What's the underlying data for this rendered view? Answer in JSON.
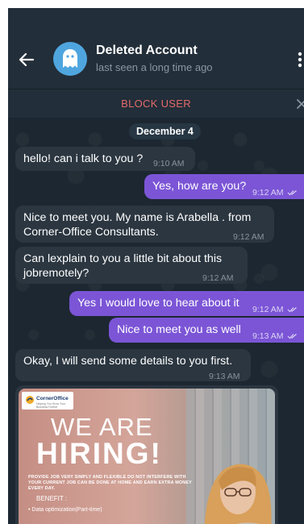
{
  "header": {
    "title": "Deleted Account",
    "status": "last seen a long time ago"
  },
  "block_bar": {
    "label": "BLOCK USER"
  },
  "date_separator": "December 4",
  "messages": [
    {
      "direction": "in",
      "text": "hello! can i talk to you ?",
      "time": "9:10 AM"
    },
    {
      "direction": "out",
      "text": "Yes, how are you?",
      "time": "9:12 AM",
      "read": true
    },
    {
      "direction": "in",
      "text_line1": "Nice to meet you. My name is Arabella . from",
      "text_line2": "Corner-Office Consultants.",
      "time": "9:12 AM"
    },
    {
      "direction": "in",
      "text_line1": "Can lexplain to you a little bit about this",
      "text_line2": "jobremotely?",
      "time": "9:12 AM"
    },
    {
      "direction": "out",
      "text": "Yes I would love to hear about it",
      "time": "9:12 AM",
      "read": true
    },
    {
      "direction": "out",
      "text": "Nice to meet you as well",
      "time": "9:13 AM",
      "read": true
    },
    {
      "direction": "in",
      "text": "Okay, I will send some details to you first.",
      "time": "9:13 AM"
    }
  ],
  "image_post": {
    "logo_name": "CornerOffice",
    "logo_tagline": "Helping You Grow Your Business Further",
    "heading_1": "WE ARE",
    "heading_2": "HIRING!",
    "description": "PROVIDE JOB VERY SIMPLY AND FLEXIBLE DO NOT INTERFERE WITH YOUR CURRENT JOB CAN BE DONE AT HOME AND EARN EXTRA MONEY EVERY DAY.",
    "benefit_label": "BENEFIT :",
    "benefit_item": "• Data optimization(Part-time)"
  },
  "colors": {
    "background": "#1c2731",
    "header": "#222e39",
    "incoming_bubble": "#2b3640",
    "outgoing_bubble": "#7b55d6",
    "block_text": "#e46a6a",
    "avatar": "#4fa6df"
  },
  "icons": {
    "back": "arrow-left-icon",
    "avatar": "ghost-icon",
    "more": "more-vertical-icon",
    "close": "close-icon",
    "read": "double-check-icon"
  }
}
